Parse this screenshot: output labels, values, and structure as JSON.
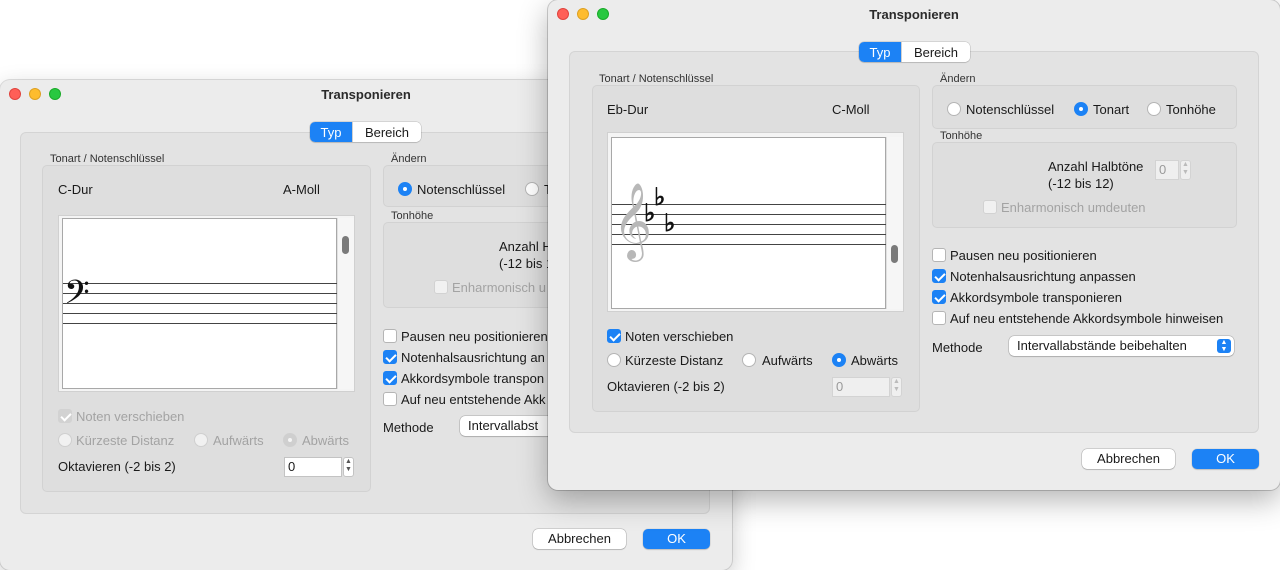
{
  "dialog_back": {
    "title": "Transponieren",
    "tabs": [
      "Typ",
      "Bereich"
    ],
    "key_group_label": "Tonart / Notenschlüssel",
    "key_from": "C-Dur",
    "key_to": "A-Moll",
    "move_notes": "Noten verschieben",
    "direction": [
      "Kürzeste Distanz",
      "Aufwärts",
      "Abwärts"
    ],
    "octaves_label": "Oktavieren (-2 bis 2)",
    "octaves_value": "0",
    "change_label": "Ändern",
    "change_options": [
      "Notenschlüssel",
      "T"
    ],
    "pitch_label": "Tonhöhe",
    "semitones_label": "Anzahl H",
    "semitones_range": "(-12 bis 1",
    "enharmonic": "Enharmonisch u",
    "options": [
      "Pausen neu positionieren",
      "Notenhalsausrichtung an",
      "Akkordsymbole transpon",
      "Auf neu entstehende Akk"
    ],
    "method_label": "Methode",
    "method_value": "Intervallabst",
    "cancel": "Abbrechen",
    "ok": "OK"
  },
  "dialog_front": {
    "title": "Transponieren",
    "tabs": [
      "Typ",
      "Bereich"
    ],
    "key_group_label": "Tonart / Notenschlüssel",
    "key_from": "Eb-Dur",
    "key_to": "C-Moll",
    "move_notes": "Noten verschieben",
    "direction": [
      "Kürzeste Distanz",
      "Aufwärts",
      "Abwärts"
    ],
    "octaves_label": "Oktavieren (-2 bis 2)",
    "octaves_value": "0",
    "change_label": "Ändern",
    "change_options": [
      "Notenschlüssel",
      "Tonart",
      "Tonhöhe"
    ],
    "pitch_label": "Tonhöhe",
    "semitones_label": "Anzahl Halbtöne",
    "semitones_range": "(-12 bis 12)",
    "semitones_value": "0",
    "enharmonic": "Enharmonisch umdeuten",
    "options": [
      "Pausen neu positionieren",
      "Notenhalsausrichtung anpassen",
      "Akkordsymbole transponieren",
      "Auf neu entstehende Akkordsymbole hinweisen"
    ],
    "method_label": "Methode",
    "method_value": "Intervallabstände beibehalten",
    "cancel": "Abbrechen",
    "ok": "OK"
  },
  "icons": {
    "bass_clef": "𝄢",
    "treble_clef": "𝄞",
    "flat": "♭",
    "step_up": "▲",
    "step_down": "▼"
  },
  "colors": {
    "accent": "#1c82f5",
    "close": "#ff5f57",
    "minimize": "#febc2e",
    "zoom": "#28c840"
  }
}
